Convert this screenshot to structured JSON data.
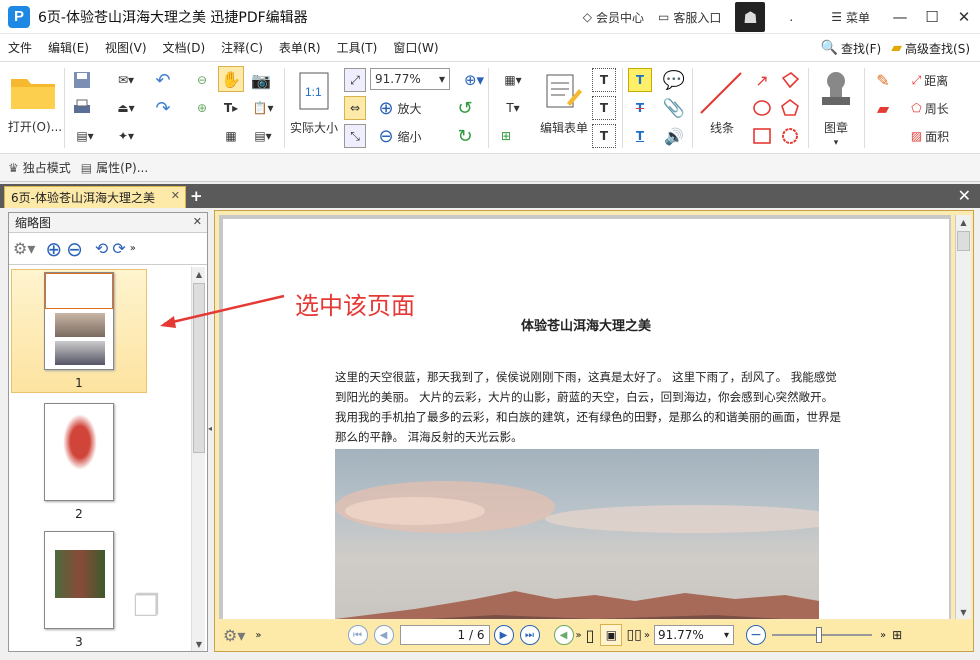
{
  "window": {
    "title": "6页-体验苍山洱海大理之美  迅捷PDF编辑器",
    "member_center": "会员中心",
    "customer_service": "客服入口",
    "dot": ".",
    "menu_label": "菜单"
  },
  "menubar": {
    "items": [
      "文件",
      "编辑(E)",
      "视图(V)",
      "文档(D)",
      "注释(C)",
      "表单(R)",
      "工具(T)",
      "窗口(W)"
    ],
    "find": "查找(F)",
    "advanced_find": "高级查找(S)"
  },
  "ribbon": {
    "open": "打开(O)...",
    "actual_size": "实际大小",
    "zoom_value": "91.77%",
    "zoom_in": "放大",
    "zoom_out": "缩小",
    "edit_form": "编辑表单",
    "lines": "线条",
    "stamp": "图章",
    "distance": "距离",
    "perimeter": "周长",
    "area": "面积"
  },
  "subbar": {
    "exclusive_mode": "独占模式",
    "properties": "属性(P)..."
  },
  "tabs": {
    "active": "6页-体验苍山洱海大理之美"
  },
  "thumbnails": {
    "title": "缩略图",
    "pages": [
      "1",
      "2",
      "3"
    ]
  },
  "document": {
    "title": "体验苍山洱海大理之美",
    "paragraph": "这里的天空很蓝，那天我到了，侯侯说刚刚下雨，这真是太好了。 这里下雨了，刮风了。 我能感觉到阳光的美丽。 大片的云彩，大片的山影，蔚蓝的天空，白云，回到海边，你会感到心突然敞开。 我用我的手机拍了最多的云彩，和白族的建筑，还有绿色的田野，是那么的和谐美丽的画面，世界是那么的平静。 洱海反射的天光云影。"
  },
  "annotation": {
    "text": "选中该页面",
    "color": "#e53935"
  },
  "statusbar": {
    "page_indicator": "1 / 6",
    "zoom_value": "91.77%"
  },
  "colors": {
    "accent_tab": "#fde9a8",
    "logo": "#1e88e5"
  }
}
